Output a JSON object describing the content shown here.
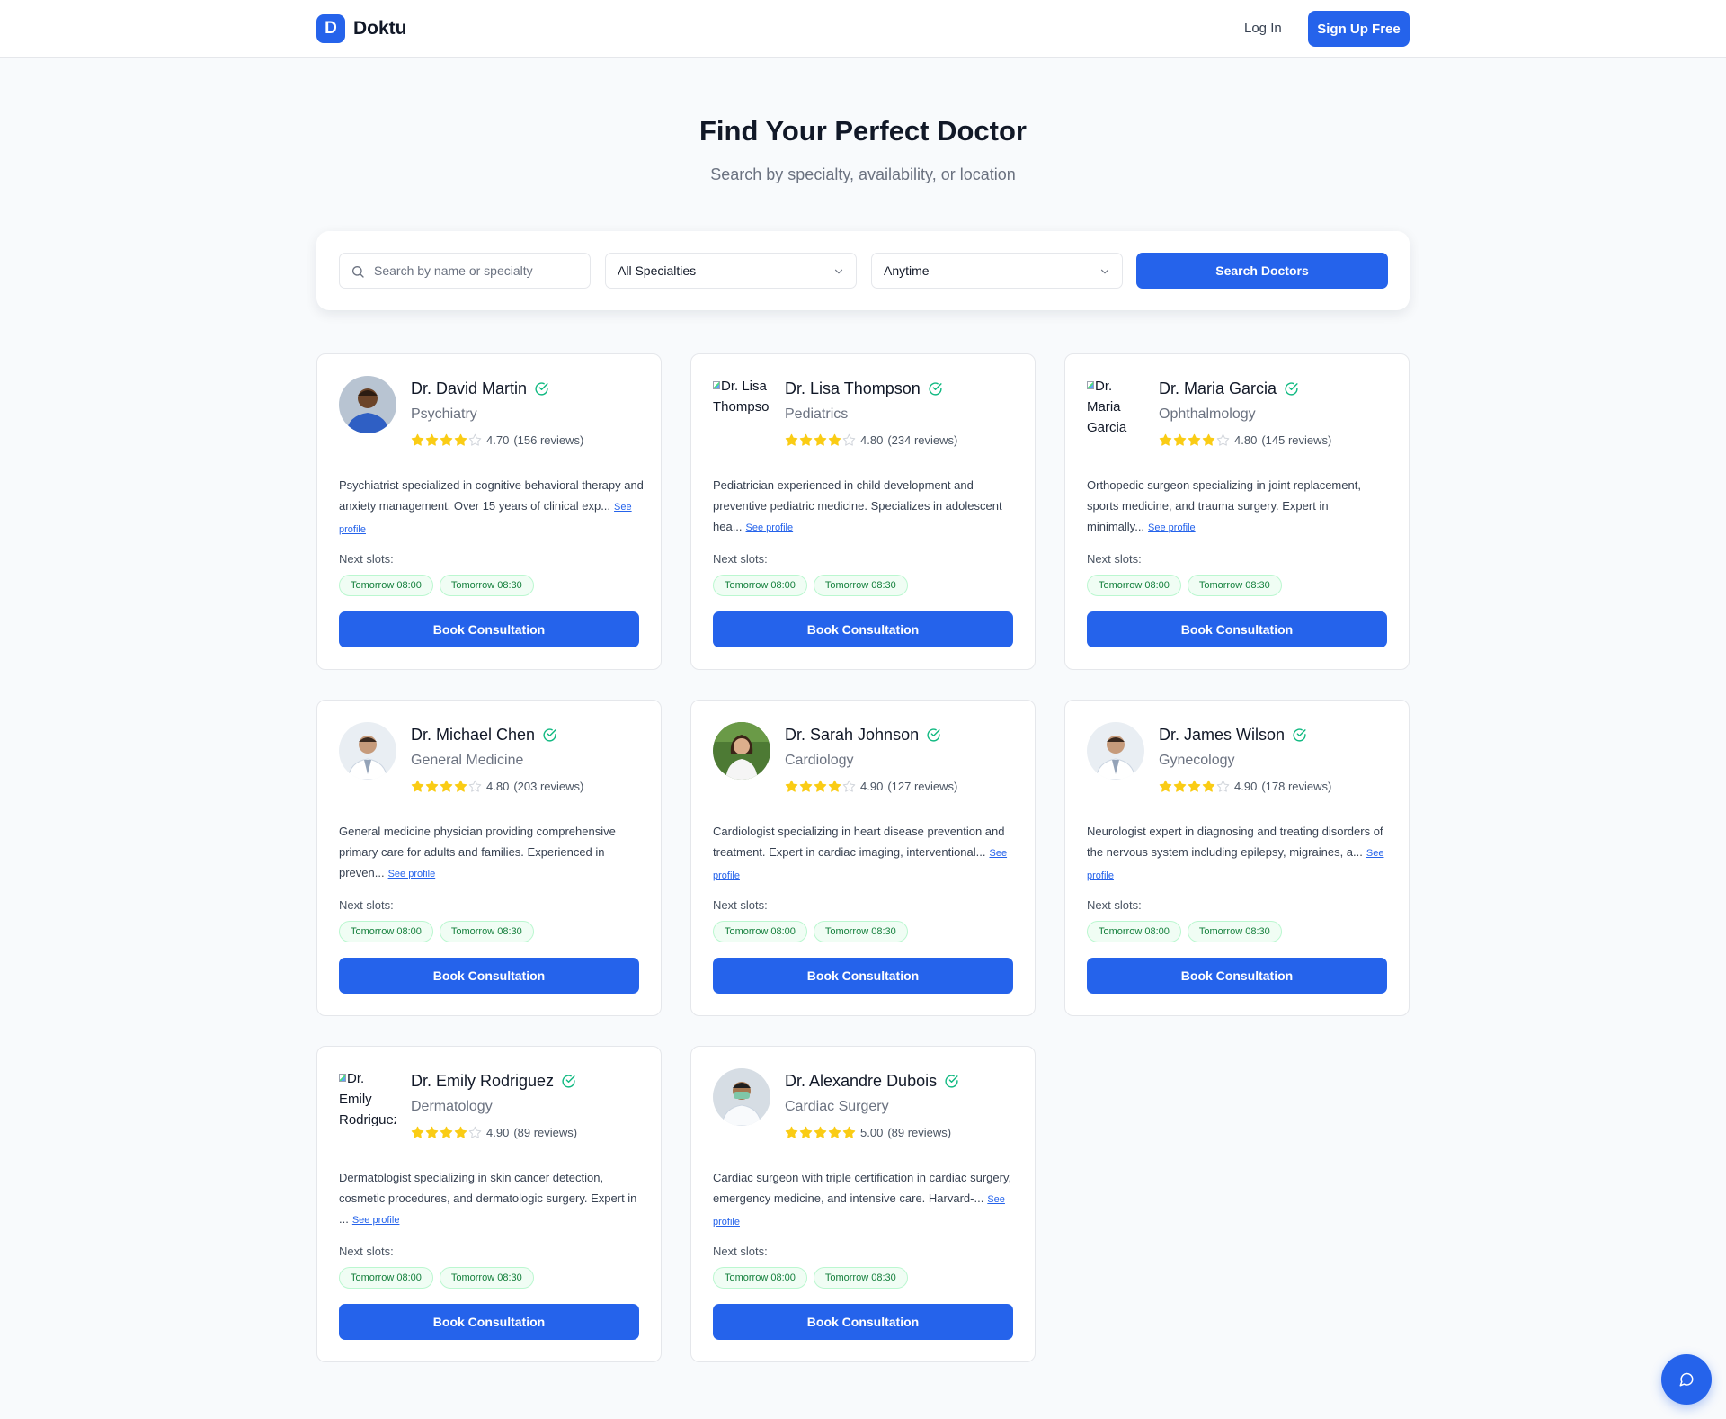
{
  "header": {
    "brand_letter": "D",
    "brand_name": "Doktu",
    "login_label": "Log In",
    "signup_label": "Sign Up Free"
  },
  "hero": {
    "title": "Find Your Perfect Doctor",
    "subtitle": "Search by specialty, availability, or location"
  },
  "search": {
    "placeholder": "Search by name or specialty",
    "value": "",
    "specialty_selected": "All Specialties",
    "availability_selected": "Anytime",
    "button_label": "Search Doctors"
  },
  "labels": {
    "next_slots": "Next slots:",
    "see_profile": "See profile",
    "book_button": "Book Consultation"
  },
  "colors": {
    "primary": "#2563eb",
    "star": "#facc15",
    "verified": "#10b981",
    "slot_text": "#15803d",
    "slot_bg": "#f0fdf4"
  },
  "doctors": [
    {
      "name": "Dr. David Martin",
      "specialty": "Psychiatry",
      "rating_value": "4.70",
      "reviews": "(156 reviews)",
      "stars_filled": 4,
      "description": "Psychiatrist specialized in cognitive behavioral therapy and anxiety management. Over 15 years of clinical exp...",
      "slots": [
        "Tomorrow 08:00",
        "Tomorrow 08:30"
      ],
      "avatar": "photo-scrubs"
    },
    {
      "name": "Dr. Lisa Thompson",
      "specialty": "Pediatrics",
      "rating_value": "4.80",
      "reviews": "(234 reviews)",
      "stars_filled": 4,
      "description": "Pediatrician experienced in child development and preventive pediatric medicine. Specializes in adolescent hea...",
      "slots": [
        "Tomorrow 08:00",
        "Tomorrow 08:30"
      ],
      "avatar": "broken",
      "avatar_alt": "Dr. Lisa Thompson"
    },
    {
      "name": "Dr. Maria Garcia",
      "specialty": "Ophthalmology",
      "rating_value": "4.80",
      "reviews": "(145 reviews)",
      "stars_filled": 4,
      "description": "Orthopedic surgeon specializing in joint replacement, sports medicine, and trauma surgery. Expert in minimally...",
      "slots": [
        "Tomorrow 08:00",
        "Tomorrow 08:30"
      ],
      "avatar": "broken",
      "avatar_alt": "Dr. Maria Garcia"
    },
    {
      "name": "Dr. Michael Chen",
      "specialty": "General Medicine",
      "rating_value": "4.80",
      "reviews": "(203 reviews)",
      "stars_filled": 4,
      "description": "General medicine physician providing comprehensive primary care for adults and families. Experienced in preven...",
      "slots": [
        "Tomorrow 08:00",
        "Tomorrow 08:30"
      ],
      "avatar": "photo-whitecoat"
    },
    {
      "name": "Dr. Sarah Johnson",
      "specialty": "Cardiology",
      "rating_value": "4.90",
      "reviews": "(127 reviews)",
      "stars_filled": 4,
      "description": "Cardiologist specializing in heart disease prevention and treatment. Expert in cardiac imaging, interventional...",
      "slots": [
        "Tomorrow 08:00",
        "Tomorrow 08:30"
      ],
      "avatar": "photo-garden"
    },
    {
      "name": "Dr. James Wilson",
      "specialty": "Gynecology",
      "rating_value": "4.90",
      "reviews": "(178 reviews)",
      "stars_filled": 4,
      "description": "Neurologist expert in diagnosing and treating disorders of the nervous system including epilepsy, migraines, a...",
      "slots": [
        "Tomorrow 08:00",
        "Tomorrow 08:30"
      ],
      "avatar": "photo-whitecoat"
    },
    {
      "name": "Dr. Emily Rodriguez",
      "specialty": "Dermatology",
      "rating_value": "4.90",
      "reviews": "(89 reviews)",
      "stars_filled": 4,
      "description": "Dermatologist specializing in skin cancer detection, cosmetic procedures, and dermatologic surgery. Expert in ...",
      "slots": [
        "Tomorrow 08:00",
        "Tomorrow 08:30"
      ],
      "avatar": "broken",
      "avatar_alt": "Dr. Emily Rodriguez"
    },
    {
      "name": "Dr. Alexandre Dubois",
      "specialty": "Cardiac Surgery",
      "rating_value": "5.00",
      "reviews": "(89 reviews)",
      "stars_filled": 5,
      "description": "Cardiac surgeon with triple certification in cardiac surgery, emergency medicine, and intensive care. Harvard-...",
      "slots": [
        "Tomorrow 08:00",
        "Tomorrow 08:30"
      ],
      "avatar": "photo-mask"
    }
  ],
  "chat": {
    "icon": "chat-bubble-icon"
  }
}
